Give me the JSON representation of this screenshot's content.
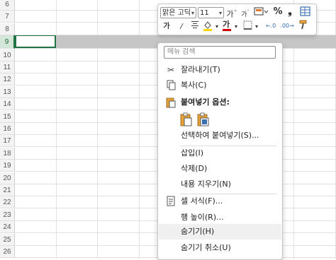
{
  "rows": [
    "6",
    "7",
    "8",
    "9",
    "10",
    "11",
    "12",
    "13",
    "14",
    "15",
    "16",
    "17",
    "18",
    "19",
    "20",
    "21",
    "22",
    "23",
    "24",
    "25",
    "26"
  ],
  "selected_row": "9",
  "mini_toolbar": {
    "font_name": "맑은 고딕",
    "font_size": "11",
    "increase_font": "가",
    "decrease_font": "가",
    "bold": "가",
    "font_color_glyph": "가",
    "percent": "%",
    "comma": "❟",
    "font_color": "#d00000",
    "fill_color": "#ffd800"
  },
  "context_menu": {
    "search_placeholder": "메뉴 검색",
    "items": {
      "cut": "잘라내기(T)",
      "copy": "복사(C)",
      "paste_options": "붙여넣기 옵션:",
      "paste_special": "선택하여 붙여넣기(S)...",
      "insert": "삽입(I)",
      "delete": "삭제(D)",
      "clear": "내용 지우기(N)",
      "format_cells": "셀 서식(F)...",
      "row_height": "행 높이(R)...",
      "hide": "숨기기(H)",
      "unhide": "숨기기 취소(U)"
    }
  }
}
